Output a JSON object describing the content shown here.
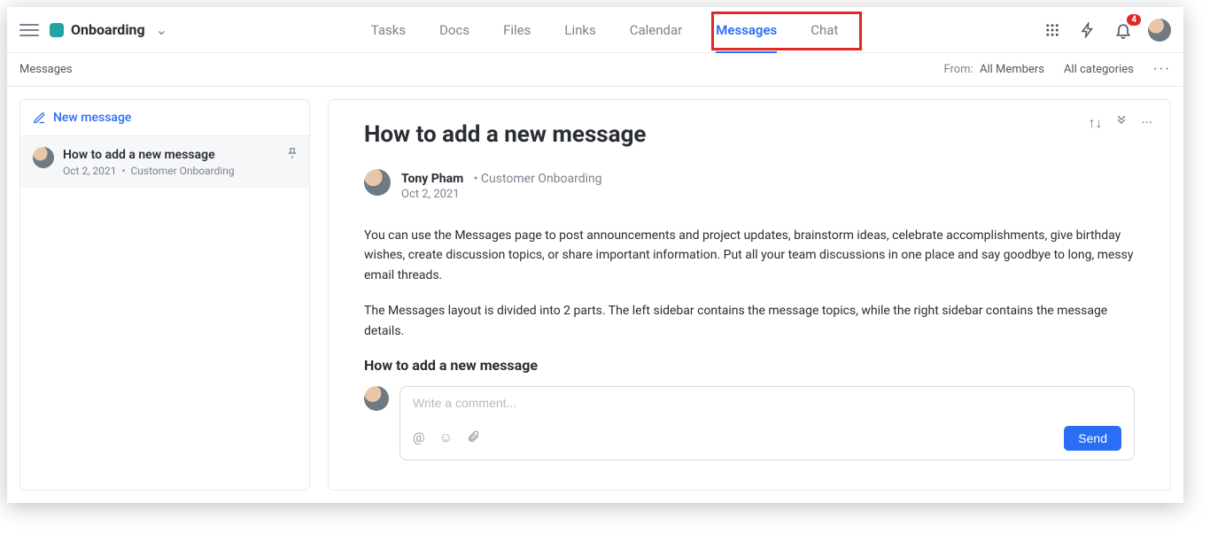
{
  "workspace": {
    "name": "Onboarding",
    "color": "#22a2a2"
  },
  "nav": {
    "tabs": [
      {
        "label": "Tasks",
        "active": false
      },
      {
        "label": "Docs",
        "active": false
      },
      {
        "label": "Files",
        "active": false
      },
      {
        "label": "Links",
        "active": false
      },
      {
        "label": "Calendar",
        "active": false
      },
      {
        "label": "Messages",
        "active": true
      },
      {
        "label": "Chat",
        "active": false
      }
    ],
    "notification_count": "4"
  },
  "filterbar": {
    "breadcrumb": "Messages",
    "from_label": "From:",
    "from_value": "All Members",
    "categories": "All categories"
  },
  "sidebar": {
    "new_message_label": "New message",
    "items": [
      {
        "title": "How to add a new message",
        "date": "Oct 2, 2021",
        "folder": "Customer Onboarding",
        "pinned": true
      }
    ]
  },
  "message": {
    "title": "How to add a new message",
    "author": "Tony Pham",
    "folder": "Customer Onboarding",
    "date": "Oct 2, 2021",
    "paragraphs": [
      "You can use the Messages page to post announcements and project updates, brainstorm ideas, celebrate accomplishments, give birthday wishes, create discussion topics, or share important information. Put all your team discussions in one place and say goodbye to long, messy email threads.",
      "The Messages layout is divided into 2 parts. The left sidebar contains the message topics, while the right sidebar contains the message details."
    ],
    "subheading": "How to add a new message"
  },
  "comment": {
    "placeholder": "Write a comment...",
    "send_label": "Send"
  }
}
